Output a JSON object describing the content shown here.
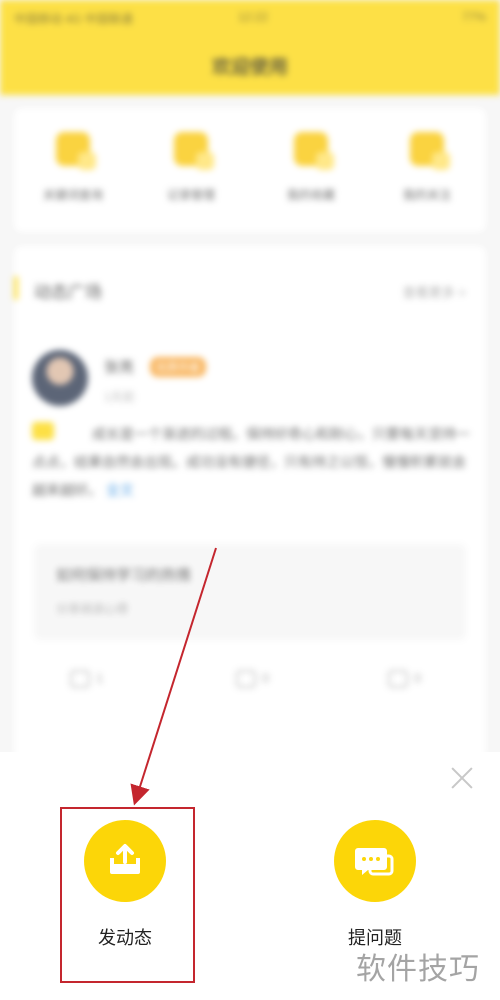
{
  "status_bar": {
    "left": "中国移动 4G 中国联通",
    "time": "12:22",
    "right": "77%"
  },
  "app": {
    "title": "欢迎使用"
  },
  "quick_actions": [
    {
      "label": "关键词查询",
      "icon": "folder-icon"
    },
    {
      "label": "记录管理",
      "icon": "folder-icon"
    },
    {
      "label": "我的收藏",
      "icon": "book-icon"
    },
    {
      "label": "我的关注",
      "icon": "bell-icon"
    }
  ],
  "feed": {
    "title": "动态广场",
    "more": "查看更多 >",
    "post": {
      "author": "张亮",
      "tag": "优质作者",
      "time": "1天前",
      "text": "成长是一个渐进的过程。保持好奇心和耐心，只要每天坚持一点点，结果自然会出现。成功没有捷径，只有持之以恒，慢慢积累就会越来越好。",
      "expand": "全文",
      "quote_title": "如何保持学习的热情",
      "quote_sub": "分享阅读心得",
      "actions": [
        "1",
        "0",
        "0"
      ]
    }
  },
  "sheet": {
    "options": [
      {
        "label": "发动态",
        "icon": "upload-icon"
      },
      {
        "label": "提问题",
        "icon": "chat-icon"
      }
    ]
  },
  "watermark": "软件技巧",
  "colors": {
    "brand_yellow": "#fcd608",
    "highlight_red": "#c4262e"
  }
}
